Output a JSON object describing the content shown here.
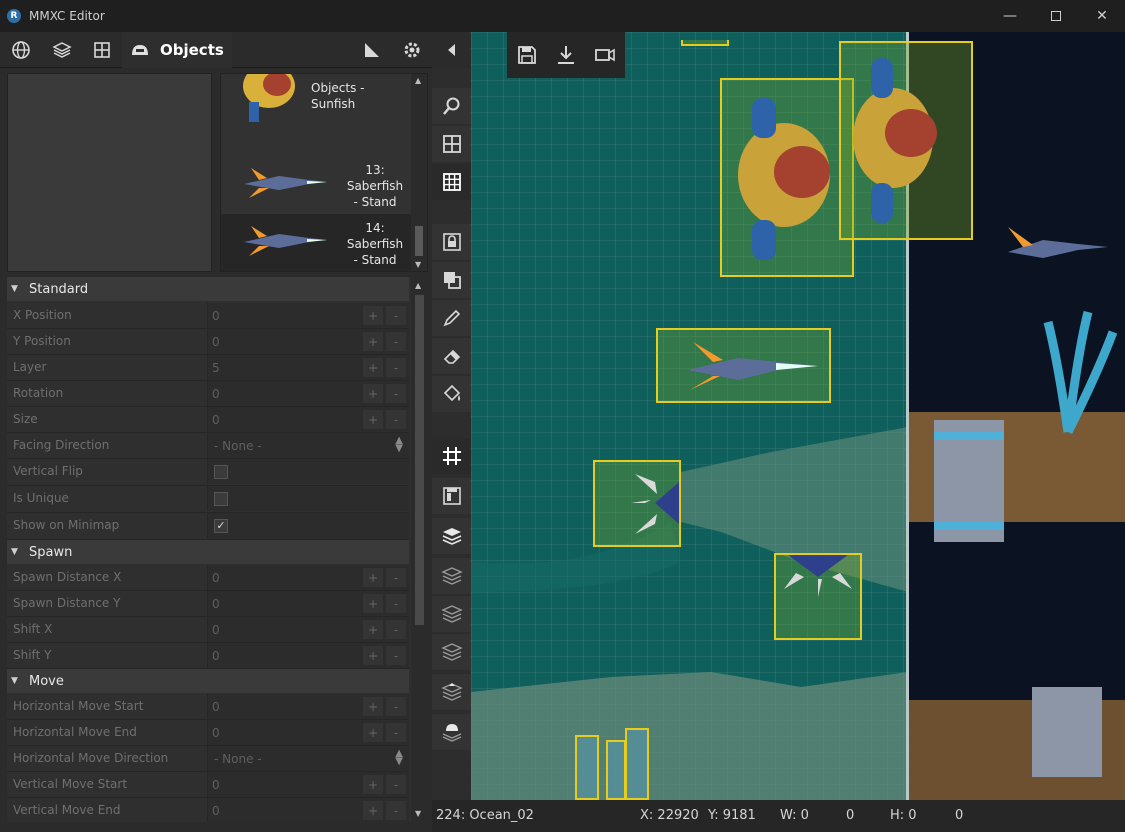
{
  "window": {
    "title": "MMXC Editor",
    "icon_letter": "R"
  },
  "tabs": {
    "active_label": "Objects"
  },
  "object_list": {
    "items": [
      {
        "label": "Objects - Sunfish"
      },
      {
        "label": "13: Saberfish - Stand"
      },
      {
        "label": "14: Saberfish - Stand"
      }
    ]
  },
  "properties": {
    "standard": {
      "title": "Standard",
      "rows": [
        {
          "name": "X Position",
          "value": "0"
        },
        {
          "name": "Y Position",
          "value": "0"
        },
        {
          "name": "Layer",
          "value": "5"
        },
        {
          "name": "Rotation",
          "value": "0"
        },
        {
          "name": "Size",
          "value": "0"
        },
        {
          "name": "Facing Direction",
          "value": "- None -"
        },
        {
          "name": "Vertical Flip"
        },
        {
          "name": "Is Unique"
        },
        {
          "name": "Show on Minimap",
          "check": "✓"
        }
      ]
    },
    "spawn": {
      "title": "Spawn",
      "rows": [
        {
          "name": "Spawn Distance X",
          "value": "0"
        },
        {
          "name": "Spawn Distance Y",
          "value": "0"
        },
        {
          "name": "Shift X",
          "value": "0"
        },
        {
          "name": "Shift Y",
          "value": "0"
        }
      ]
    },
    "move": {
      "title": "Move",
      "rows": [
        {
          "name": "Horizontal Move Start",
          "value": "0"
        },
        {
          "name": "Horizontal Move End",
          "value": "0"
        },
        {
          "name": "Horizontal Move Direction",
          "value": "- None -"
        },
        {
          "name": "Vertical Move Start",
          "value": "0"
        },
        {
          "name": "Vertical Move End",
          "value": "0"
        }
      ]
    },
    "plus": "+",
    "minus": "-"
  },
  "status": {
    "level": "224: Ocean_02",
    "x": "X: 22920",
    "y": "Y: 9181",
    "w": "W: 0",
    "w2": "0",
    "h": "H: 0",
    "h2": "0"
  }
}
